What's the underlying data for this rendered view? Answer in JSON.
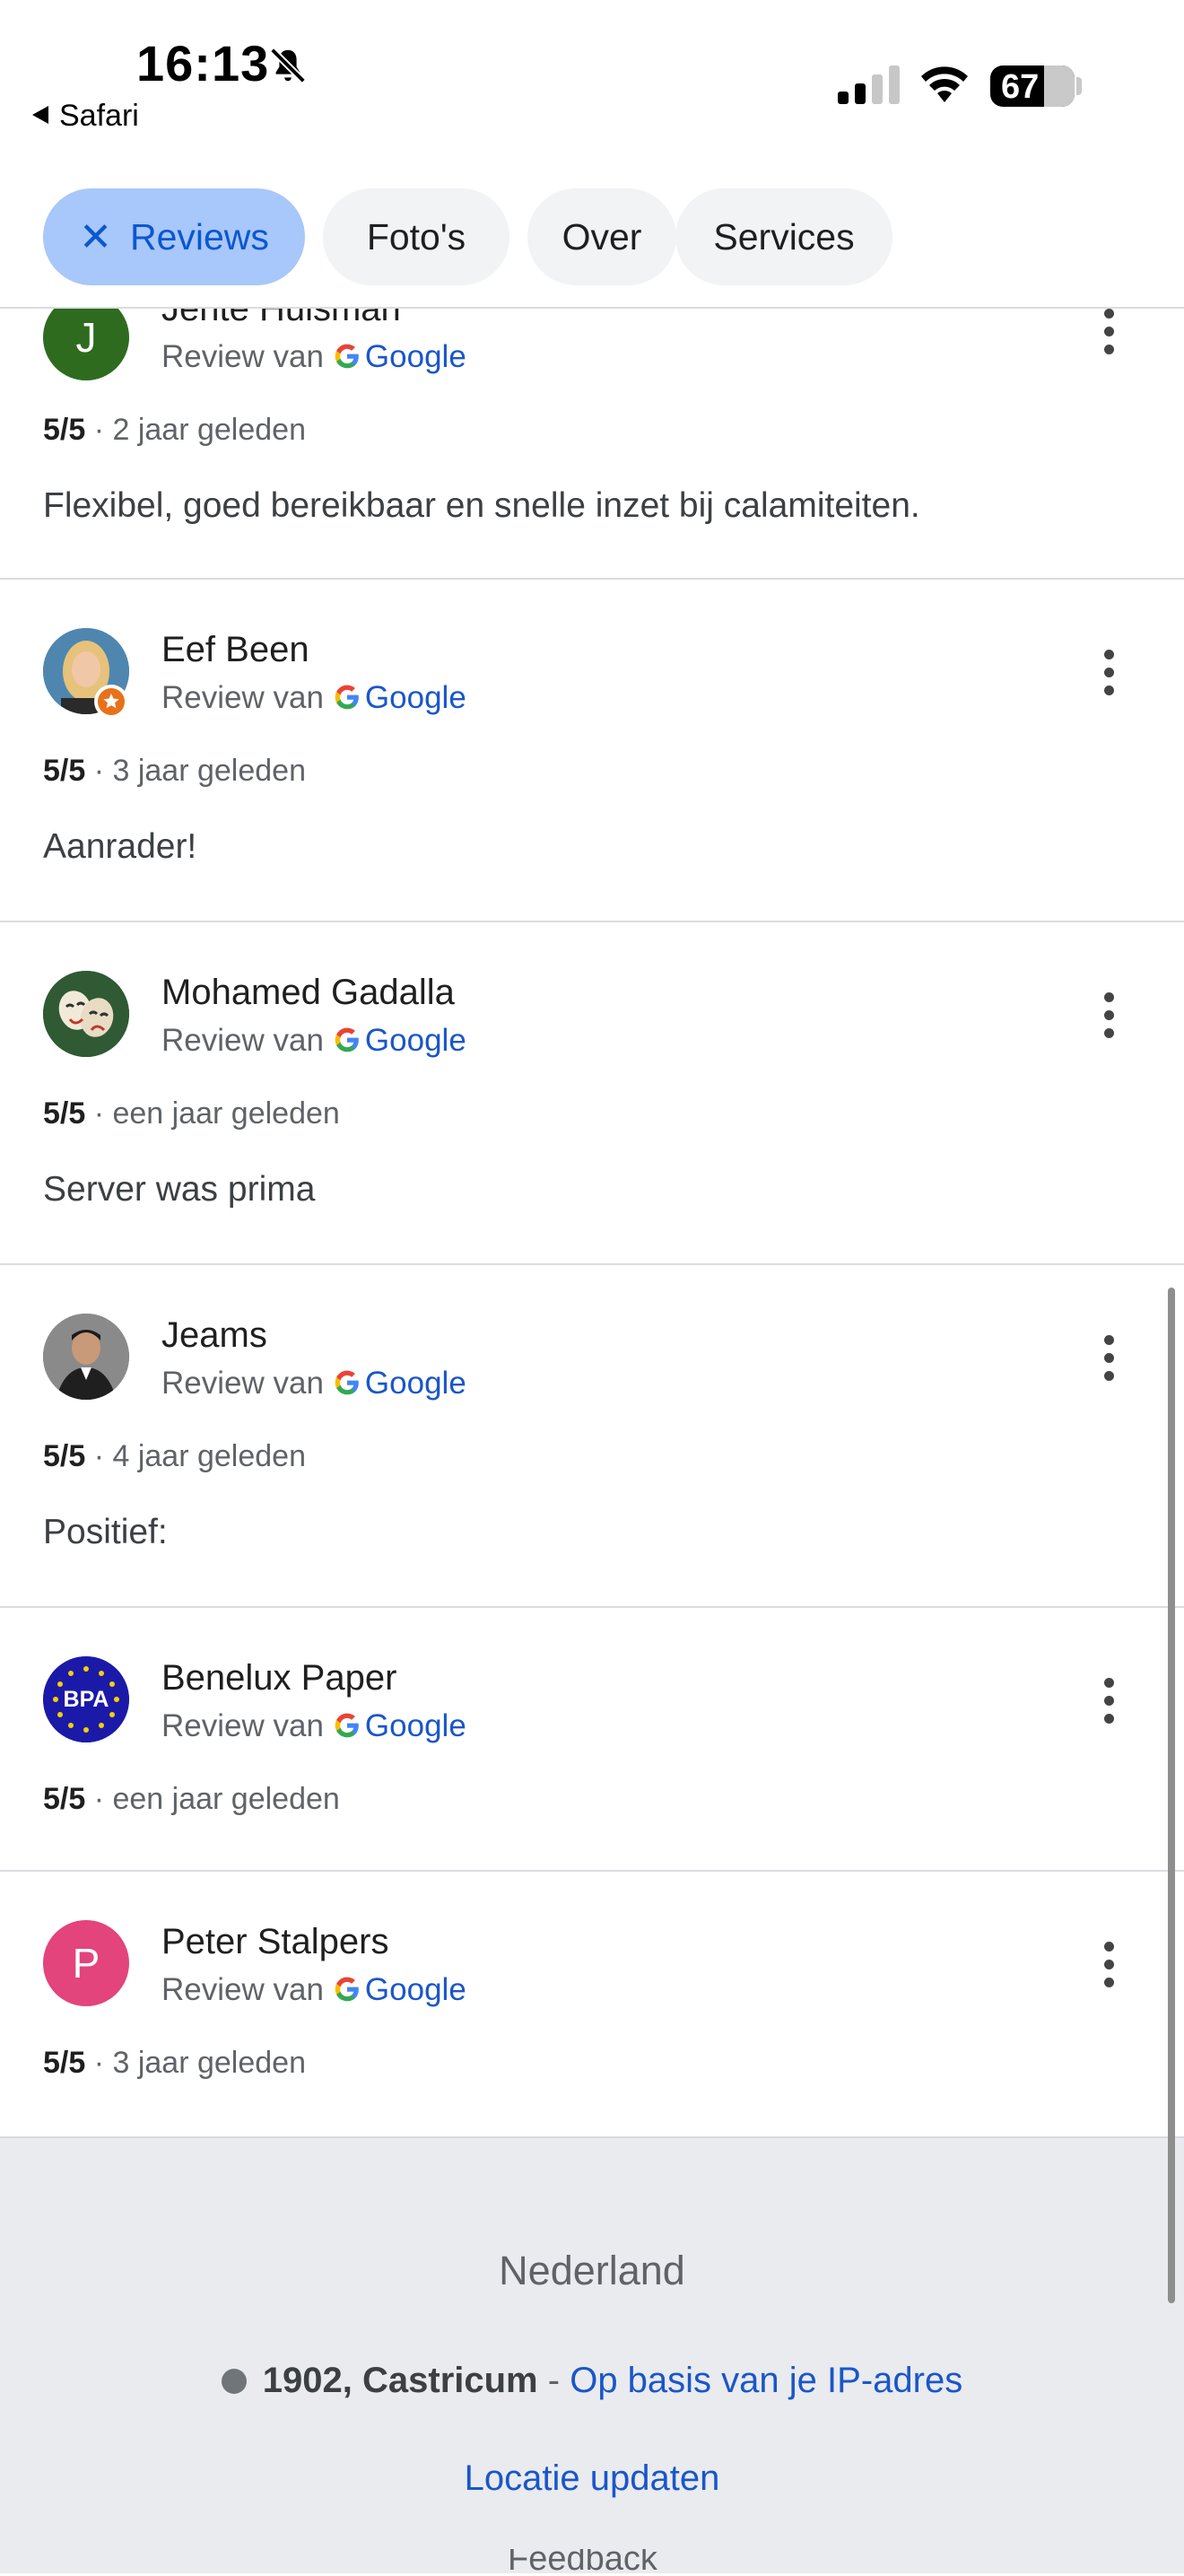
{
  "status_bar": {
    "time": "16:13",
    "back_label": "Safari",
    "battery": "67"
  },
  "chips": [
    {
      "label": "Reviews",
      "active": true
    },
    {
      "label": "Foto's",
      "active": false
    },
    {
      "label": "Over",
      "active": false
    },
    {
      "label": "Services",
      "active": false
    }
  ],
  "reviews": [
    {
      "name": "Jente Huisman",
      "avatar": "J",
      "source_prefix": "Review van",
      "source": "Google",
      "rating": "5/5",
      "time": "· 2 jaar geleden",
      "text": "Flexibel, goed bereikbaar en snelle inzet bij calamiteiten."
    },
    {
      "name": "Eef Been",
      "avatar": "",
      "source_prefix": "Review van",
      "source": "Google",
      "rating": "5/5",
      "time": "· 3 jaar geleden",
      "text": "Aanrader!"
    },
    {
      "name": "Mohamed Gadalla",
      "avatar": "",
      "source_prefix": "Review van",
      "source": "Google",
      "rating": "5/5",
      "time": "· een jaar geleden",
      "text": "Server was prima"
    },
    {
      "name": "Jeams",
      "avatar": "",
      "source_prefix": "Review van",
      "source": "Google",
      "rating": "5/5",
      "time": "· 4 jaar geleden",
      "text": "Positief:"
    },
    {
      "name": "Benelux Paper",
      "avatar": "BPA",
      "source_prefix": "Review van",
      "source": "Google",
      "rating": "5/5",
      "time": "· een jaar geleden",
      "text": ""
    },
    {
      "name": "Peter Stalpers",
      "avatar": "P",
      "source_prefix": "Review van",
      "source": "Google",
      "rating": "5/5",
      "time": "· 3 jaar geleden",
      "text": ""
    }
  ],
  "footer": {
    "country": "Nederland",
    "location": "1902, Castricum",
    "separator": "-",
    "location_source": "Op basis van je IP-adres",
    "update_link": "Locatie updaten",
    "partial_text": "Feedback"
  },
  "colors": {
    "chip_active_bg": "#a8c7fa",
    "link_blue": "#1a56c9",
    "avatar_j": "#2e6b1f",
    "avatar_p": "#e2447b",
    "avatar_bpa": "#1b1aa8"
  },
  "icons": {
    "status": [
      "bell-slash-icon",
      "cellular-signal-icon",
      "wifi-icon",
      "battery-icon"
    ],
    "chip_close": "close-icon",
    "review_menu": "more-vert-icon",
    "source_logo": "google-logo-icon"
  }
}
